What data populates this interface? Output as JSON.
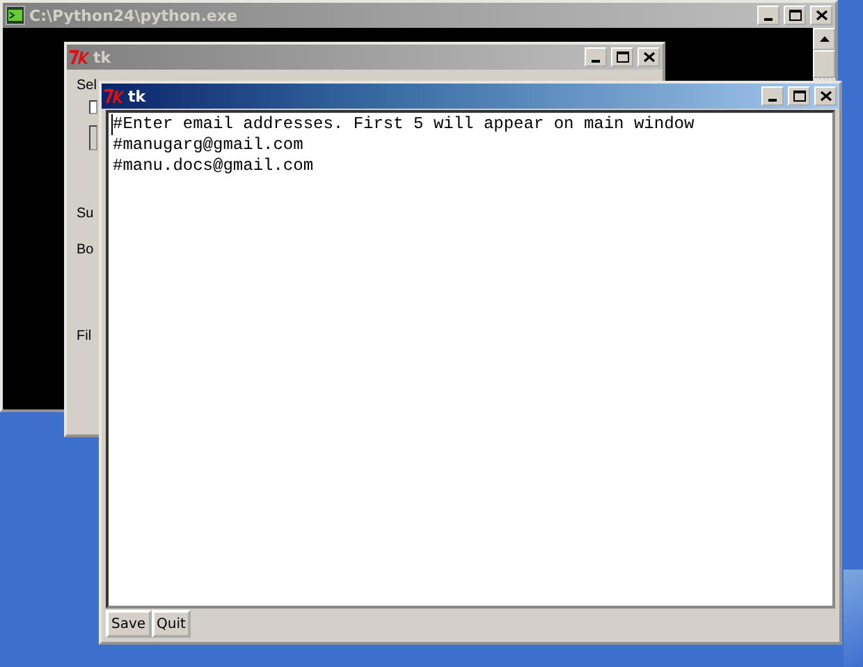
{
  "console_window": {
    "title": "C:\\Python24\\python.exe",
    "active": false
  },
  "back_window": {
    "title": "tk",
    "active": false,
    "labels": [
      "Sel",
      "Su",
      "Bo",
      "Fil"
    ],
    "checkbox": {
      "checked": false
    }
  },
  "front_window": {
    "title": "tk",
    "active": true,
    "lines": [
      "#Enter email addresses. First 5 will appear on main window",
      "#manugarg@gmail.com",
      "#manu.docs@gmail.com"
    ],
    "buttons": [
      "Save",
      "Quit"
    ]
  }
}
